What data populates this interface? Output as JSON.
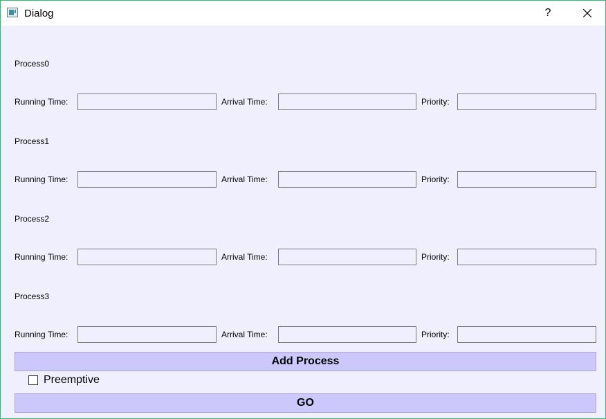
{
  "window": {
    "title": "Dialog",
    "help_label": "?",
    "close_icon": "close-icon"
  },
  "processes": [
    {
      "name": "Process0",
      "running_label": "Running Time:",
      "running_value": "",
      "arrival_label": "Arrival Time:",
      "arrival_value": "",
      "priority_label": "Priority:",
      "priority_value": ""
    },
    {
      "name": "Process1",
      "running_label": "Running Time:",
      "running_value": "",
      "arrival_label": "Arrival Time:",
      "arrival_value": "",
      "priority_label": "Priority:",
      "priority_value": ""
    },
    {
      "name": "Process2",
      "running_label": "Running Time:",
      "running_value": "",
      "arrival_label": "Arrival Time:",
      "arrival_value": "",
      "priority_label": "Priority:",
      "priority_value": ""
    },
    {
      "name": "Process3",
      "running_label": "Running Time:",
      "running_value": "",
      "arrival_label": "Arrival Time:",
      "arrival_value": "",
      "priority_label": "Priority:",
      "priority_value": ""
    }
  ],
  "actions": {
    "add_process_label": "Add Process",
    "preemptive_label": "Preemptive",
    "preemptive_checked": false,
    "go_label": "GO"
  },
  "colors": {
    "background": "#f0effd",
    "button": "#ccc8fb",
    "border_accent": "#2eb872"
  }
}
